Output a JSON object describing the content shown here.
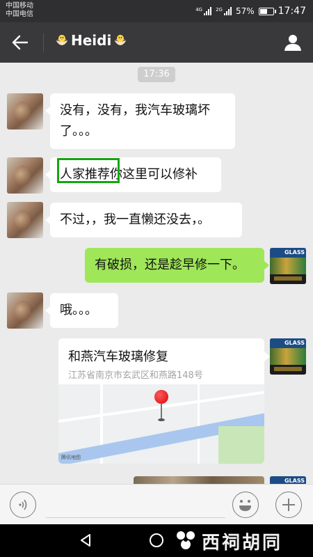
{
  "status_bar": {
    "carrier_1": "中国移动",
    "carrier_2": "中国电信",
    "net_1": "4G",
    "net_2": "2G",
    "battery": "57%",
    "battery_level": 0.57,
    "time": "17:47"
  },
  "header": {
    "title": "Heidi",
    "back_icon": "arrow-left-icon",
    "profile_icon": "person-icon"
  },
  "chat": {
    "timestamp": "17:36",
    "messages": [
      {
        "side": "left",
        "text": "没有，没有，我汽车玻璃坏了。。。"
      },
      {
        "side": "left",
        "text": "人家推荐你这里可以修补"
      },
      {
        "side": "left",
        "text": "不过，，我一直懒还没去，。"
      },
      {
        "side": "right",
        "text": "有破损，还是趁早修一下。"
      },
      {
        "side": "left",
        "text": "哦。。。"
      }
    ],
    "location": {
      "title": "和燕汽车玻璃修复",
      "address": "江苏省南京市玄武区和燕路148号",
      "map_provider": "腾讯地图"
    },
    "avatar_right_text": "GLASS"
  },
  "input_bar": {
    "placeholder": "",
    "voice_icon": "voice-icon",
    "emoji_icon": "emoji-icon",
    "plus_icon": "plus-icon"
  },
  "nav_bar": {
    "watermark": "西祠胡同"
  },
  "colors": {
    "header_bg": "#39393b",
    "chat_bg": "#ebebeb",
    "outgoing_bubble": "#9fe658",
    "highlight": "#14a60f"
  }
}
